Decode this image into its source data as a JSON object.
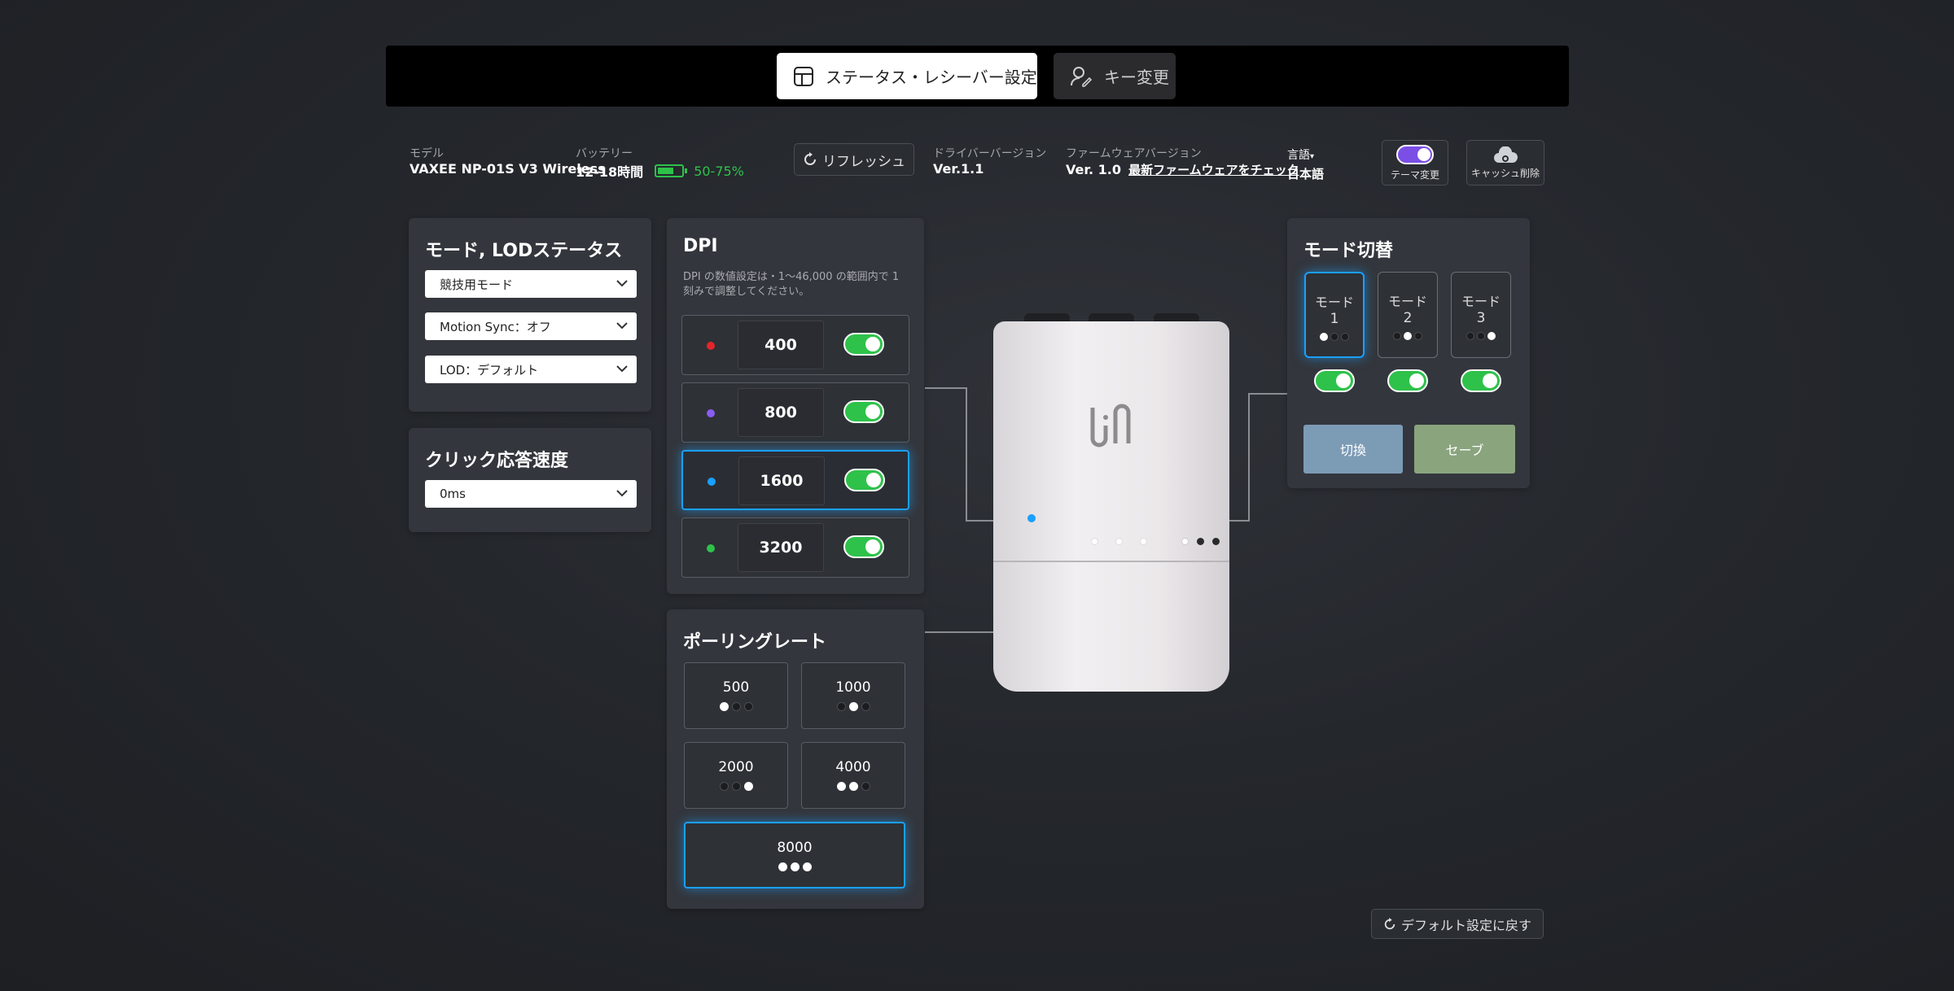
{
  "tabs": {
    "status": "ステータス・レシーバー設定",
    "key": "キー変更"
  },
  "info": {
    "model_label": "モデル",
    "model_value": "VAXEE NP-01S V3 Wireless",
    "battery_label": "バッテリー",
    "battery_time": "12-18時間",
    "battery_percent": "50-75%",
    "refresh_label": "リフレッシュ",
    "driver_label": "ドライバーバージョン",
    "driver_value": "Ver.1.1",
    "firmware_label": "ファームウェアバージョン",
    "firmware_value": "Ver. 1.0",
    "firmware_check": "最新ファームウェアをチェック",
    "language_label": "言語",
    "language_value": "日本語",
    "theme_label": "テーマ変更",
    "cache_label": "キャッシュ削除"
  },
  "mode_panel": {
    "title": "モード, LODステータス",
    "mode_select": "競技用モード",
    "motion_sync_select": "Motion Sync：オフ",
    "lod_select": "LOD：デフォルト"
  },
  "click_panel": {
    "title": "クリック応答速度",
    "value": "0ms"
  },
  "dpi_panel": {
    "title": "DPI",
    "description_line1": "DPI の数値設定は・1～46,000 の範囲内で 1",
    "description_line2": "刻みで調整してください。",
    "rows": [
      {
        "value": "400",
        "color": "#e3262b",
        "enabled": true,
        "selected": false
      },
      {
        "value": "800",
        "color": "#8a5cf0",
        "enabled": true,
        "selected": false
      },
      {
        "value": "1600",
        "color": "#1aa0ff",
        "enabled": true,
        "selected": true
      },
      {
        "value": "3200",
        "color": "#2ec24a",
        "enabled": true,
        "selected": false
      }
    ]
  },
  "polling_panel": {
    "title": "ポーリングレート",
    "rates": [
      {
        "value": "500",
        "dots": [
          true,
          false,
          false
        ],
        "selected": false
      },
      {
        "value": "1000",
        "dots": [
          false,
          true,
          false
        ],
        "selected": false
      },
      {
        "value": "2000",
        "dots": [
          false,
          false,
          true
        ],
        "selected": false
      },
      {
        "value": "4000",
        "dots": [
          true,
          true,
          false
        ],
        "selected": false
      },
      {
        "value": "8000",
        "dots": [
          true,
          true,
          true
        ],
        "selected": true
      }
    ]
  },
  "mode_switch_panel": {
    "title": "モード切替",
    "modes": [
      {
        "label": "モード",
        "number": "1",
        "dots": [
          true,
          false,
          false
        ],
        "selected": true,
        "enabled": true
      },
      {
        "label": "モード",
        "number": "2",
        "dots": [
          false,
          true,
          false
        ],
        "selected": false,
        "enabled": true
      },
      {
        "label": "モード",
        "number": "3",
        "dots": [
          false,
          false,
          true
        ],
        "selected": false,
        "enabled": true
      }
    ],
    "switch_button": "切換",
    "save_button": "セーブ"
  },
  "reset_button": "デフォルト設定に戻す",
  "colors": {
    "accent_blue": "#1aa0ff",
    "toggle_green": "#2ec24a",
    "switch_button": "#7c9bb5",
    "save_button": "#8aa47e",
    "theme_toggle": "#7b4ee6"
  }
}
